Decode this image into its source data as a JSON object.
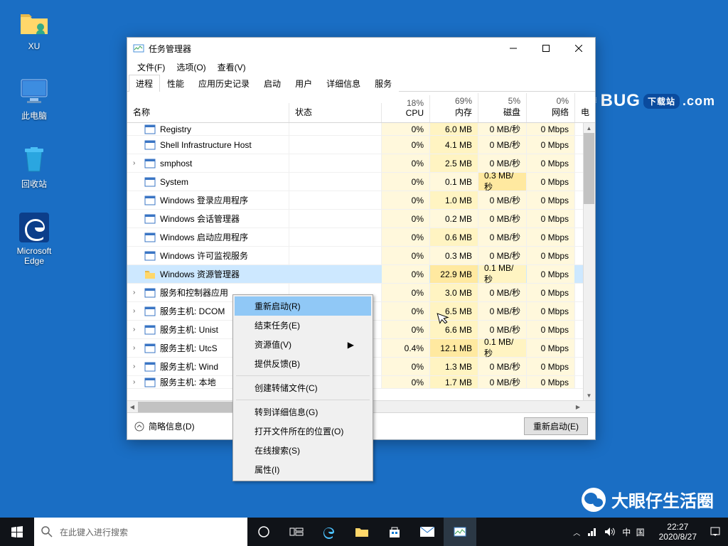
{
  "desktop": {
    "icons": [
      {
        "key": "xu",
        "label": "XU"
      },
      {
        "key": "pc",
        "label": "此电脑"
      },
      {
        "key": "bin",
        "label": "回收站"
      },
      {
        "key": "edge",
        "label": "Microsoft Edge"
      }
    ]
  },
  "watermark": {
    "brand_left": "U",
    "brand_bug": "BUG",
    "brand_tag": "下载站",
    "brand_domain": ".com",
    "bottom": "大眼仔生活圈"
  },
  "window": {
    "title": "任务管理器",
    "menus": [
      "文件(F)",
      "选项(O)",
      "查看(V)"
    ],
    "tabs": [
      "进程",
      "性能",
      "应用历史记录",
      "启动",
      "用户",
      "详细信息",
      "服务"
    ],
    "active_tab": 0,
    "headers": {
      "name": "名称",
      "status": "状态",
      "cpu_pct": "18%",
      "cpu": "CPU",
      "mem_pct": "69%",
      "mem": "内存",
      "disk_pct": "5%",
      "disk": "磁盘",
      "net_pct": "0%",
      "net": "网络",
      "power": "电"
    },
    "rows": [
      {
        "name": "Registry",
        "chev": "",
        "cpu": "0%",
        "mem": "6.0 MB",
        "disk": "0 MB/秒",
        "net": "0 Mbps",
        "cpu_h": 0,
        "mem_h": 1,
        "disk_h": 0,
        "net_h": 0,
        "partial": true
      },
      {
        "name": "Shell Infrastructure Host",
        "chev": "",
        "cpu": "0%",
        "mem": "4.1 MB",
        "disk": "0 MB/秒",
        "net": "0 Mbps",
        "cpu_h": 0,
        "mem_h": 1,
        "disk_h": 0,
        "net_h": 0
      },
      {
        "name": "smphost",
        "chev": "›",
        "cpu": "0%",
        "mem": "2.5 MB",
        "disk": "0 MB/秒",
        "net": "0 Mbps",
        "cpu_h": 0,
        "mem_h": 1,
        "disk_h": 0,
        "net_h": 0
      },
      {
        "name": "System",
        "chev": "",
        "cpu": "0%",
        "mem": "0.1 MB",
        "disk": "0.3 MB/秒",
        "net": "0 Mbps",
        "cpu_h": 0,
        "mem_h": 0,
        "disk_h": 2,
        "net_h": 0
      },
      {
        "name": "Windows 登录应用程序",
        "chev": "",
        "cpu": "0%",
        "mem": "1.0 MB",
        "disk": "0 MB/秒",
        "net": "0 Mbps",
        "cpu_h": 0,
        "mem_h": 1,
        "disk_h": 0,
        "net_h": 0
      },
      {
        "name": "Windows 会话管理器",
        "chev": "",
        "cpu": "0%",
        "mem": "0.2 MB",
        "disk": "0 MB/秒",
        "net": "0 Mbps",
        "cpu_h": 0,
        "mem_h": 0,
        "disk_h": 0,
        "net_h": 0
      },
      {
        "name": "Windows 启动应用程序",
        "chev": "",
        "cpu": "0%",
        "mem": "0.6 MB",
        "disk": "0 MB/秒",
        "net": "0 Mbps",
        "cpu_h": 0,
        "mem_h": 1,
        "disk_h": 0,
        "net_h": 0
      },
      {
        "name": "Windows 许可监视服务",
        "chev": "",
        "cpu": "0%",
        "mem": "0.3 MB",
        "disk": "0 MB/秒",
        "net": "0 Mbps",
        "cpu_h": 0,
        "mem_h": 0,
        "disk_h": 0,
        "net_h": 0
      },
      {
        "name": "Windows 资源管理器",
        "chev": "",
        "cpu": "0%",
        "mem": "22.9 MB",
        "disk": "0.1 MB/秒",
        "net": "0 Mbps",
        "cpu_h": 0,
        "mem_h": 2,
        "disk_h": 1,
        "net_h": 0,
        "selected": true,
        "icon": "explorer"
      },
      {
        "name": "服务和控制器应用",
        "chev": "›",
        "cpu": "0%",
        "mem": "3.0 MB",
        "disk": "0 MB/秒",
        "net": "0 Mbps",
        "cpu_h": 0,
        "mem_h": 1,
        "disk_h": 0,
        "net_h": 0
      },
      {
        "name": "服务主机: DCOM",
        "chev": "›",
        "cpu": "0%",
        "mem": "6.5 MB",
        "disk": "0 MB/秒",
        "net": "0 Mbps",
        "cpu_h": 0,
        "mem_h": 1,
        "disk_h": 0,
        "net_h": 0,
        "truncated": true
      },
      {
        "name": "服务主机: Unist",
        "chev": "›",
        "cpu": "0%",
        "mem": "6.6 MB",
        "disk": "0 MB/秒",
        "net": "0 Mbps",
        "cpu_h": 0,
        "mem_h": 1,
        "disk_h": 0,
        "net_h": 0,
        "truncated": true
      },
      {
        "name": "服务主机: UtcS",
        "chev": "›",
        "cpu": "0.4%",
        "mem": "12.1 MB",
        "disk": "0.1 MB/秒",
        "net": "0 Mbps",
        "cpu_h": 1,
        "mem_h": 2,
        "disk_h": 1,
        "net_h": 0,
        "truncated": true
      },
      {
        "name": "服务主机: Wind",
        "chev": "›",
        "cpu": "0%",
        "mem": "1.3 MB",
        "disk": "0 MB/秒",
        "net": "0 Mbps",
        "cpu_h": 0,
        "mem_h": 1,
        "disk_h": 0,
        "net_h": 0,
        "truncated": true
      },
      {
        "name": "服务主机: 本地",
        "chev": "›",
        "cpu": "0%",
        "mem": "1.7 MB",
        "disk": "0 MB/秒",
        "net": "0 Mbps",
        "cpu_h": 0,
        "mem_h": 1,
        "disk_h": 0,
        "net_h": 0,
        "truncated": true,
        "partial": true
      }
    ],
    "footer": {
      "details": "简略信息(D)",
      "action": "重新启动(E)"
    },
    "context_menu": {
      "items": [
        {
          "label": "重新启动(R)",
          "highlight": true
        },
        {
          "label": "结束任务(E)"
        },
        {
          "label": "资源值(V)",
          "submenu": true
        },
        {
          "label": "提供反馈(B)"
        },
        {
          "sep": true
        },
        {
          "label": "创建转储文件(C)"
        },
        {
          "sep": true
        },
        {
          "label": "转到详细信息(G)"
        },
        {
          "label": "打开文件所在的位置(O)"
        },
        {
          "label": "在线搜索(S)"
        },
        {
          "label": "属性(I)"
        }
      ]
    }
  },
  "taskbar": {
    "search_placeholder": "在此键入进行搜索",
    "ime": "中 国",
    "time": "22:27",
    "date": "2020/8/27"
  }
}
